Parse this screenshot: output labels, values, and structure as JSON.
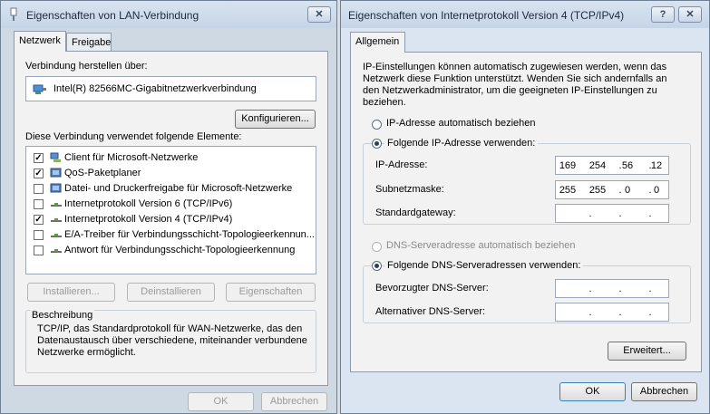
{
  "lan_window": {
    "title": "Eigenschaften von LAN-Verbindung",
    "close_label": "✕",
    "tabs": [
      "Netzwerk",
      "Freigabe"
    ],
    "connect_via_label": "Verbindung herstellen über:",
    "adapter_name": "Intel(R) 82566MC-Gigabitnetzwerkverbindung",
    "configure_button": "Konfigurieren...",
    "components_label": "Diese Verbindung verwendet folgende Elemente:",
    "components": [
      {
        "label": "Client für Microsoft-Netzwerke",
        "checked": true,
        "icon": "network-client-icon"
      },
      {
        "label": "QoS-Paketplaner",
        "checked": true,
        "icon": "service-icon"
      },
      {
        "label": "Datei- und Druckerfreigabe für Microsoft-Netzwerke",
        "checked": false,
        "icon": "service-icon"
      },
      {
        "label": "Internetprotokoll Version 6 (TCP/IPv6)",
        "checked": false,
        "icon": "protocol-icon"
      },
      {
        "label": "Internetprotokoll Version 4 (TCP/IPv4)",
        "checked": true,
        "icon": "protocol-icon"
      },
      {
        "label": "E/A-Treiber für Verbindungsschicht-Topologieerkennun...",
        "checked": false,
        "icon": "protocol-icon"
      },
      {
        "label": "Antwort für Verbindungsschicht-Topologieerkennung",
        "checked": false,
        "icon": "protocol-icon"
      }
    ],
    "install_button": "Installieren...",
    "uninstall_button": "Deinstallieren",
    "properties_button": "Eigenschaften",
    "description_label": "Beschreibung",
    "description_lines": [
      "TCP/IP, das Standardprotokoll für WAN-Netzwerke, das den",
      "Datenaustausch über verschiedene, miteinander verbundene",
      "Netzwerke ermöglicht."
    ],
    "ok_button": "OK",
    "cancel_button": "Abbrechen"
  },
  "ipv4_window": {
    "title": "Eigenschaften von Internetprotokoll Version 4 (TCP/IPv4)",
    "help_label": "?",
    "close_label": "✕",
    "tab": "Allgemein",
    "intro_lines": [
      "IP-Einstellungen können automatisch zugewiesen werden, wenn das",
      "Netzwerk diese Funktion unterstützt. Wenden Sie sich andernfalls an",
      "den Netzwerkadministrator, um die geeigneten IP-Einstellungen zu",
      "beziehen."
    ],
    "auto_ip_label": "IP-Adresse automatisch beziehen",
    "manual_ip_label": "Folgende IP-Adresse verwenden:",
    "ip_address_label": "IP-Adresse:",
    "ip_address": [
      "169",
      "254",
      "56",
      "12"
    ],
    "subnet_label": "Subnetzmaske:",
    "subnet_mask": [
      "255",
      "255",
      "0",
      "0"
    ],
    "gateway_label": "Standardgateway:",
    "gateway": [
      "",
      "",
      "",
      ""
    ],
    "auto_dns_label": "DNS-Serveradresse automatisch beziehen",
    "manual_dns_label": "Folgende DNS-Serveradressen verwenden:",
    "preferred_dns_label": "Bevorzugter DNS-Server:",
    "preferred_dns": [
      "",
      "",
      "",
      ""
    ],
    "alternate_dns_label": "Alternativer DNS-Server:",
    "alternate_dns": [
      "",
      "",
      "",
      ""
    ],
    "advanced_button": "Erweitert...",
    "ok_button": "OK",
    "cancel_button": "Abbrechen"
  },
  "colors": {
    "accent": "#2c3e55",
    "disabled_text": "#9a9a9a"
  }
}
